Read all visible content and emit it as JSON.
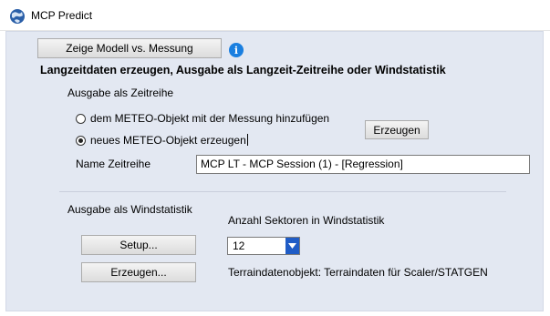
{
  "window": {
    "title": "MCP Predict"
  },
  "top": {
    "toggle_button_label": "Zeige Modell vs. Messung"
  },
  "section": {
    "heading": "Langzeitdaten erzeugen, Ausgabe als Langzeit-Zeitreihe oder Windstatistik"
  },
  "timeseries": {
    "heading": "Ausgabe als Zeitreihe",
    "radio_add_label": "dem METEO-Objekt mit der Messung hinzufügen",
    "radio_new_label": "neues METEO-Objekt erzeugen",
    "selected": "new",
    "generate_button_label": "Erzeugen",
    "name_label": "Name Zeitreihe",
    "name_value": "MCP LT - MCP Session (1) -  [Regression]"
  },
  "windstat": {
    "heading": "Ausgabe als Windstatistik",
    "setup_button_label": "Setup...",
    "generate_button_label": "Erzeugen...",
    "sectors_label": "Anzahl Sektoren in Windstatistik",
    "sectors_value": "12",
    "terrain_label": "Terraindatenobjekt: Terraindaten für Scaler/STATGEN"
  },
  "colors": {
    "panel_bg": "#e3e8f2",
    "accent_blue": "#1a7fe0",
    "combo_arrow": "#1f5cc6"
  },
  "icons": {
    "app": "globe-app-icon",
    "info": "info-icon",
    "combo": "chevron-down-icon"
  }
}
